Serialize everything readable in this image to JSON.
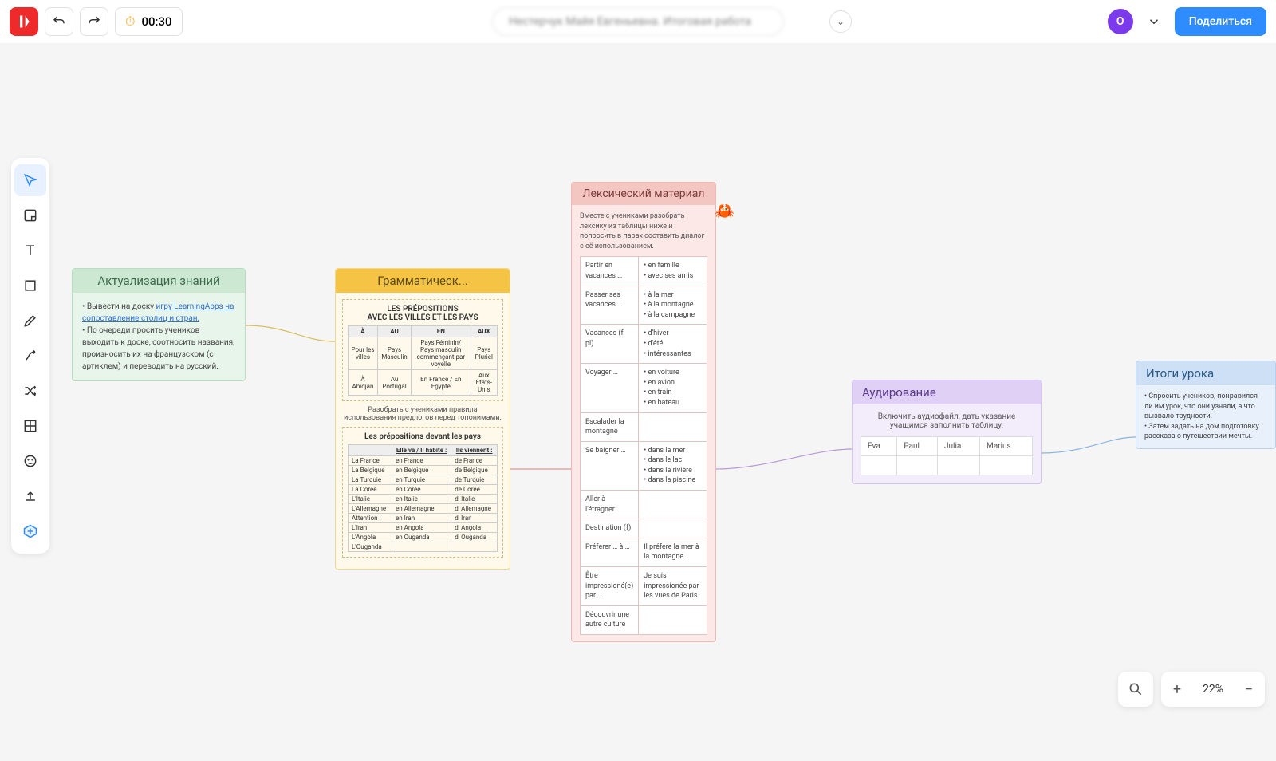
{
  "header": {
    "timer": "00:30",
    "title": "Нестерчук Майя Евгеньевна. Итоговая работа",
    "avatar": "O",
    "share": "Поделиться"
  },
  "zoom": {
    "value": "22%"
  },
  "cards": {
    "c1": {
      "title": "Актуализация знаний",
      "pre": "• Вывести на доску ",
      "link": "игру LearningApps на сопоставление столиц и стран.",
      "post": "• По очереди просить учеников выходить к доске, соотносить названия, произносить их на французском (с артиклем) и переводить на русский."
    },
    "c2": {
      "title": "Грамматическ...",
      "img_title": "LES PRÉPOSITIONS\nAVEC LES VILLES ET LES PAYS",
      "tbl1_head": [
        "À",
        "AU",
        "EN",
        "AUX"
      ],
      "tbl1_r1": [
        "Pour les villes",
        "Pays Masculin",
        "Pays Féminin/ Pays masculin commençant par voyelle",
        "Pays Pluriel"
      ],
      "tbl1_r2": [
        "À Abidjan",
        "Au Portugal",
        "En France / En Egypte",
        "Aux États-Unis"
      ],
      "note1": "Разобрать с учениками правила использования предлогов перед топонимами.",
      "tbl2_title": "Les prépositions devant les pays",
      "tbl2_head": [
        "",
        "Elle va / Il habite :",
        "Ils viennent :"
      ],
      "tbl2_rows": [
        [
          "La France",
          "en France",
          "de France"
        ],
        [
          "La Belgique",
          "en Belgique",
          "de Belgique"
        ],
        [
          "La Turquie",
          "en Turquie",
          "de Turquie"
        ],
        [
          "La Corée",
          "en Corée",
          "de Corée"
        ],
        [
          "L'Italie",
          "en Italie",
          "d' Italie"
        ],
        [
          "L'Allemagne",
          "en Allemagne",
          "d' Allemagne"
        ],
        [
          "Attention !",
          "en Iran",
          "d' Iran"
        ],
        [
          "L'Iran",
          "en Angola",
          "d' Angola"
        ],
        [
          "L'Angola",
          "en Ouganda",
          "d' Ouganda"
        ],
        [
          "L'Ouganda",
          "",
          ""
        ]
      ]
    },
    "c3": {
      "title": "Лексический материал",
      "intro": "Вместе с учениками разобрать лексику из таблицы ниже и попросить в парах составить диалог с её использованием.",
      "rows": [
        {
          "l": "Partir en vacances …",
          "r": [
            "• en famille",
            "• avec ses amis"
          ]
        },
        {
          "l": "Passer ses vacances …",
          "r": [
            "• à la mer",
            "• à la montagne",
            "• à la campagne"
          ]
        },
        {
          "l": "Vacances (f, pl)",
          "r": [
            "• d'hiver",
            "• d'été",
            "• intéressantes"
          ]
        },
        {
          "l": "Voyager …",
          "r": [
            "• en voiture",
            "• en avion",
            "• en train",
            "• en bateau"
          ]
        },
        {
          "l": "Escalader la montagne",
          "r": []
        },
        {
          "l": "Se baigner …",
          "r": [
            "• dans la mer",
            "• dans le lac",
            "• dans la rivière",
            "• dans la piscine"
          ]
        },
        {
          "l": "Aller à l'étragner",
          "r": []
        },
        {
          "l": "Destination (f)",
          "r": []
        },
        {
          "l": "Préferer … à …",
          "r": [
            "Il préfere la mer à la montagne."
          ]
        },
        {
          "l": "Être impressioné(e) par …",
          "r": [
            "Je suis impressionée par les vues de Paris."
          ]
        },
        {
          "l": "Découvrir une autre culture",
          "r": []
        }
      ]
    },
    "c4": {
      "title": "Аудирование",
      "intro": "Включить аудиофайл, дать указание учащимся заполнить таблицу.",
      "cols": [
        "Eva",
        "Paul",
        "Julia",
        "Marius"
      ]
    },
    "c5": {
      "title": "Итоги урока",
      "body": "• Спросить учеников, понравился ли им урок, что они узнали, а что вызвало трудности.\n• Затем задать на дом подготовку рассказа о путешествии мечты."
    }
  }
}
